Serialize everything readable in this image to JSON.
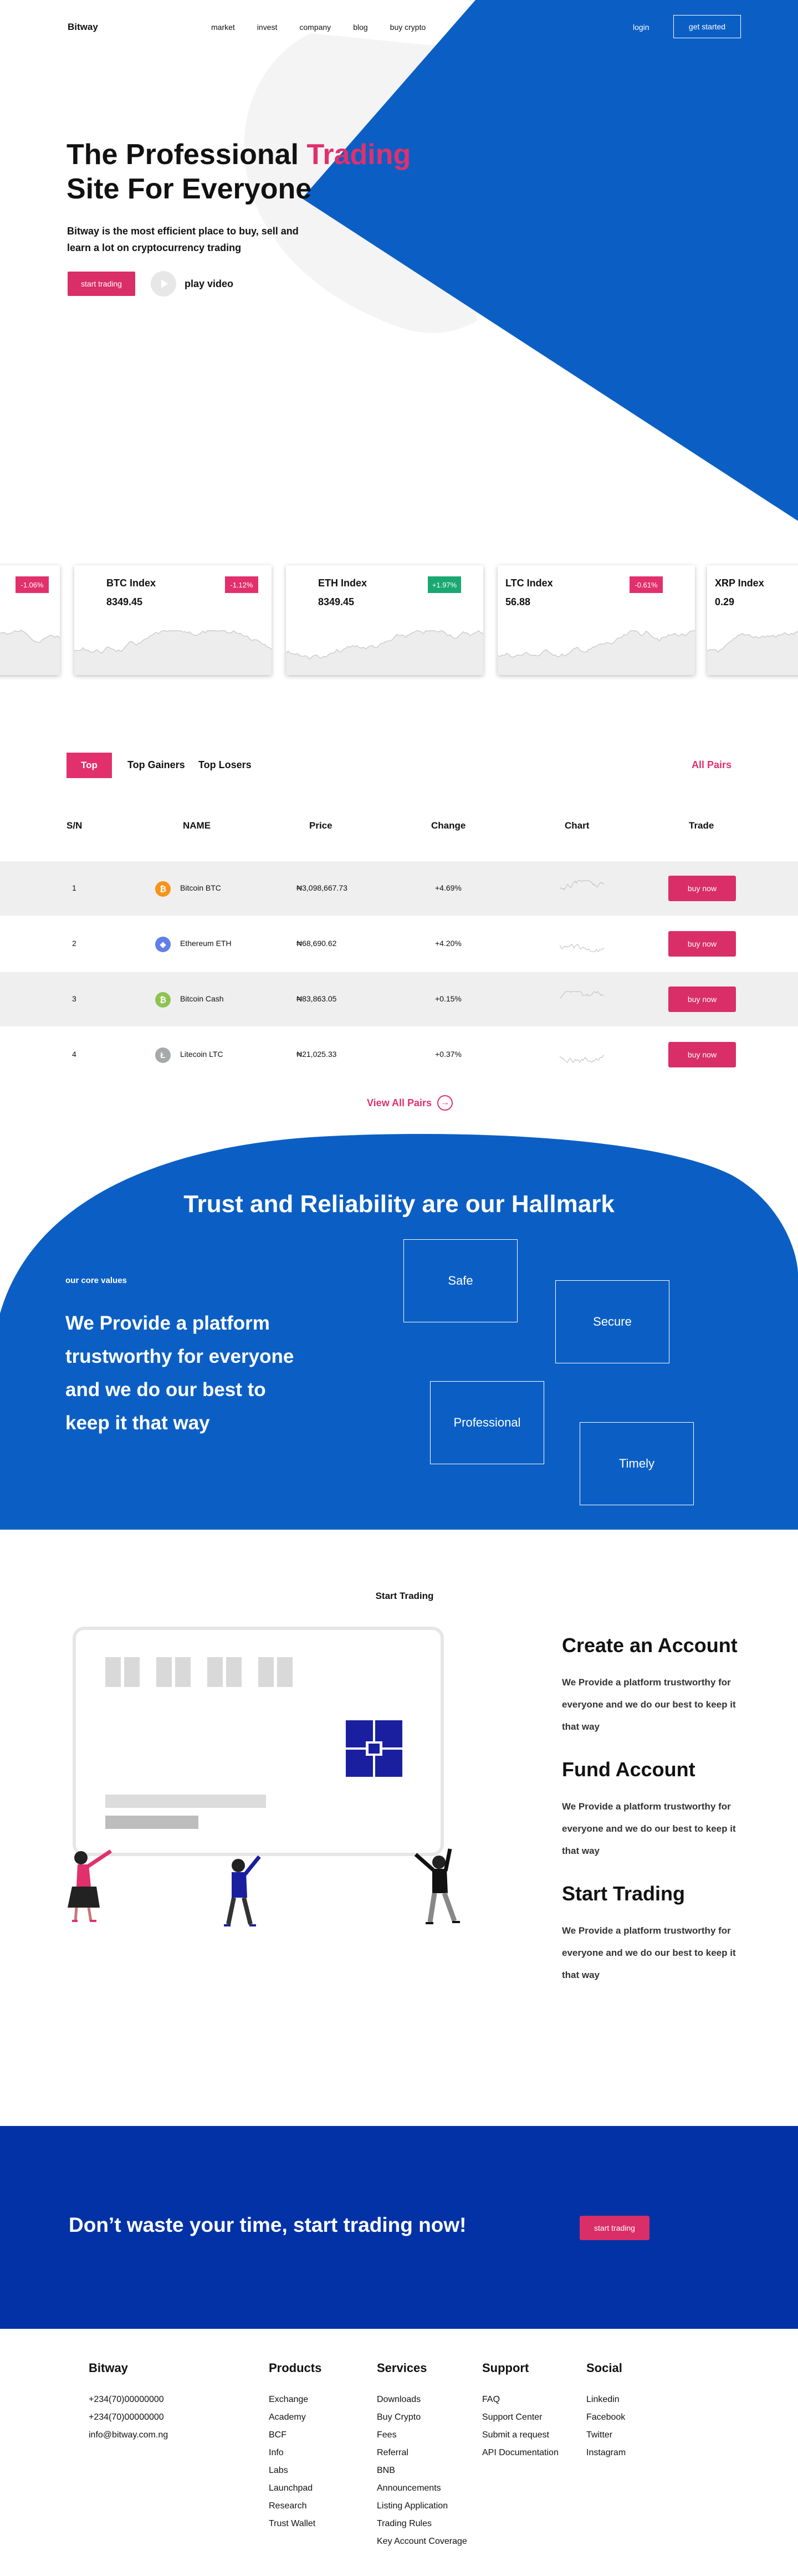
{
  "nav": {
    "logo": "Bitway",
    "menu": [
      "market",
      "invest",
      "company",
      "blog",
      "buy crypto"
    ],
    "login": "login",
    "get_started": "get started"
  },
  "hero": {
    "title_part1": "The Professional ",
    "title_accent": "Trading",
    "title_part2": "Site For Everyone",
    "subtitle": "Bitway is the most efficient place to buy, sell and learn a lot on cryptocurrency trading",
    "start_button": "start trading",
    "play_label": "play video"
  },
  "indices": [
    {
      "name": "",
      "value": "",
      "change": "-1.06%",
      "direction": "neg"
    },
    {
      "name": "BTC Index",
      "value": "8349.45",
      "change": "-1.12%",
      "direction": "neg"
    },
    {
      "name": "ETH Index",
      "value": "8349.45",
      "change": "+1.97%",
      "direction": "pos"
    },
    {
      "name": "LTC Index",
      "value": "56.88",
      "change": "-0.61%",
      "direction": "neg"
    },
    {
      "name": "XRP Index",
      "value": "0.29",
      "change": "",
      "direction": "neg"
    }
  ],
  "market": {
    "tabs": [
      "Top",
      "Top Gainers",
      "Top Losers"
    ],
    "all_pairs": "All Pairs",
    "columns": [
      "S/N",
      "NAME",
      "Price",
      "Change",
      "Chart",
      "Trade"
    ],
    "rows": [
      {
        "sn": "1",
        "coin": "Bitcoin   BTC",
        "icon_glyph": "₿",
        "icon_color": "#f7931a",
        "price": "₦3,098,667.73",
        "change": "+4.69%",
        "buy": "buy now"
      },
      {
        "sn": "2",
        "coin": "Ethereum ETH",
        "icon_glyph": "◆",
        "icon_color": "#627eea",
        "price": "₦68,690.62",
        "change": "+4.20%",
        "buy": "buy now"
      },
      {
        "sn": "3",
        "coin": "Bitcoin    Cash",
        "icon_glyph": "₿",
        "icon_color": "#8dc351",
        "price": "₦83,863.05",
        "change": "+0.15%",
        "buy": "buy now"
      },
      {
        "sn": "4",
        "coin": "Litecoin LTC",
        "icon_glyph": "Ł",
        "icon_color": "#a6a9aa",
        "price": "₦21,025.33",
        "change": "+0.37%",
        "buy": "buy now"
      }
    ],
    "view_all": "View All Pairs"
  },
  "trust": {
    "heading": "Trust and Reliability are our Hallmark",
    "core_values": "our core values",
    "statement": "We Provide a platform trustworthy for everyone and we do our best to keep it that way",
    "boxes": [
      "Safe",
      "Secure",
      "Professional",
      "Timely"
    ]
  },
  "start_trading": {
    "title": "Start Trading",
    "steps": [
      {
        "heading": "Create an Account",
        "text": "We Provide a platform  trustworthy for everyone and we do our best to keep it that way"
      },
      {
        "heading": "Fund Account",
        "text": "We Provide a platform  trustworthy for everyone and we do our best to keep it that way"
      },
      {
        "heading": "Start Trading",
        "text": "We Provide a platform  trustworthy for everyone and we do our best to keep it that way"
      }
    ]
  },
  "cta": {
    "text": "Don’t waste your time, start trading now!",
    "button": "start trading"
  },
  "footer": {
    "brand": {
      "title": "Bitway",
      "items": [
        "+234(70)00000000",
        "+234(70)00000000",
        "info@bitway.com.ng"
      ]
    },
    "products": {
      "title": "Products",
      "items": [
        "Exchange",
        "Academy",
        "BCF",
        "Info",
        "Labs",
        "Launchpad",
        "Research",
        "Trust Wallet"
      ]
    },
    "services": {
      "title": "Services",
      "items": [
        "Downloads",
        "Buy Crypto",
        "Fees",
        "Referral",
        "BNB",
        "Announcements",
        "Listing Application",
        "Trading Rules",
        "Key Account Coverage"
      ]
    },
    "support": {
      "title": "Support",
      "items": [
        "FAQ",
        "Support Center",
        "Submit a request",
        "API Documentation"
      ]
    },
    "social": {
      "title": "Social",
      "items": [
        "Linkedin",
        "Facebook",
        "Twitter",
        "Instagram"
      ]
    }
  },
  "colors": {
    "brand_blue": "#0b5fc4",
    "deep_blue": "#0232a6",
    "accent_pink": "#e1306c",
    "positive_green": "#1aa872"
  }
}
